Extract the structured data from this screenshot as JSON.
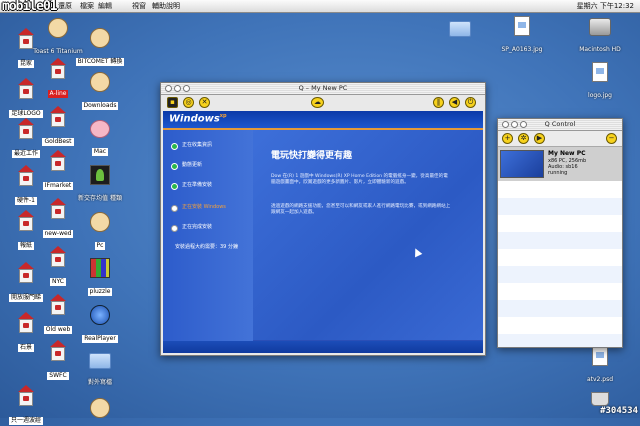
{
  "menubar": {
    "logo": "mobile01",
    "menus": [
      "還原",
      "檔案",
      "編輯",
      "視窗",
      "輔助說明"
    ],
    "clock": "星期六 下午12:32"
  },
  "desktop_icons_left": [
    {
      "label": "昆家",
      "kind": "milk"
    },
    {
      "label": "足球LOGO",
      "kind": "milk"
    },
    {
      "label": "最近工作",
      "kind": "milk"
    },
    {
      "label": "硬件-1",
      "kind": "milk"
    },
    {
      "label": "報紙",
      "kind": "milk"
    },
    {
      "label": "開放服門睇",
      "kind": "milk"
    },
    {
      "label": "石景",
      "kind": "milk"
    },
    {
      "label": "只一週波經",
      "kind": "milk"
    }
  ],
  "desktop_icons_mid": [
    {
      "label": "Toast 6 Titanium",
      "kind": "round"
    },
    {
      "label": "A-line",
      "kind": "milk",
      "style": "red"
    },
    {
      "label": "GoldBest",
      "kind": "milk"
    },
    {
      "label": "IFmarket",
      "kind": "milk"
    },
    {
      "label": "new-wed",
      "kind": "milk"
    },
    {
      "label": "NYC",
      "kind": "milk"
    },
    {
      "label": "Old web",
      "kind": "milk"
    },
    {
      "label": "SWFC",
      "kind": "milk"
    }
  ],
  "desktop_icons_col3": [
    {
      "label": "BITCOMET 轉換",
      "kind": "round"
    },
    {
      "label": "Downloads",
      "kind": "round"
    },
    {
      "label": "Mac",
      "kind": "pink"
    },
    {
      "label": "新交存均值 種類",
      "kind": "plant"
    },
    {
      "label": "Pc",
      "kind": "round"
    },
    {
      "label": "pluzzle",
      "kind": "grid"
    },
    {
      "label": "RealPlayer",
      "kind": "rp"
    },
    {
      "label": "對外寫檔",
      "kind": "folder"
    }
  ],
  "desktop_icons_right": [
    {
      "label": "SP_A0163.jpg",
      "kind": "doc"
    },
    {
      "label": "Macintosh HD",
      "kind": "drive"
    },
    {
      "label": "logo.jpg",
      "kind": "doc"
    },
    {
      "label": "atv2.psd",
      "kind": "doc"
    }
  ],
  "q_window": {
    "title": "Q – My New PC",
    "xp_logo": "Windows",
    "xp_logo_sup": "xp",
    "steps": [
      {
        "label": "正在收集資訊",
        "state": "done"
      },
      {
        "label": "動態更新",
        "state": "done"
      },
      {
        "label": "正在準備安裝",
        "state": "done"
      },
      {
        "label": "正在安裝 Windows",
        "state": "active"
      },
      {
        "label": "正在完成安裝",
        "state": "pending"
      }
    ],
    "remaining": "安裝過程大約需要：39 分鐘",
    "headline": "電玩快打變得更有趣",
    "para1": "Dow 在(R) 1 遊戲中 Windows(R) XP Home Edition 的電腦搖身一變，從高最佳的電腦遊戲畫面中，欣賞遊戲的更多新圖片、影片，立即體驗新的遊戲。",
    "para2": "透過遊戲的網路支援功能，您甚至可以和網友或家人進行網路電玩比賽，或到網路網站上跟網友一起加入遊戲。"
  },
  "q_control": {
    "title": "Q Control",
    "vm": {
      "name": "My New PC",
      "spec": "x86 PC, 256mb",
      "audio": "Audio: sb16",
      "status": "running"
    }
  },
  "watermark": "#304534",
  "colors": {
    "accent_xp": "#2a4fb7",
    "milk_red": "#c8282a",
    "button_yellow": "#f7d21d"
  }
}
